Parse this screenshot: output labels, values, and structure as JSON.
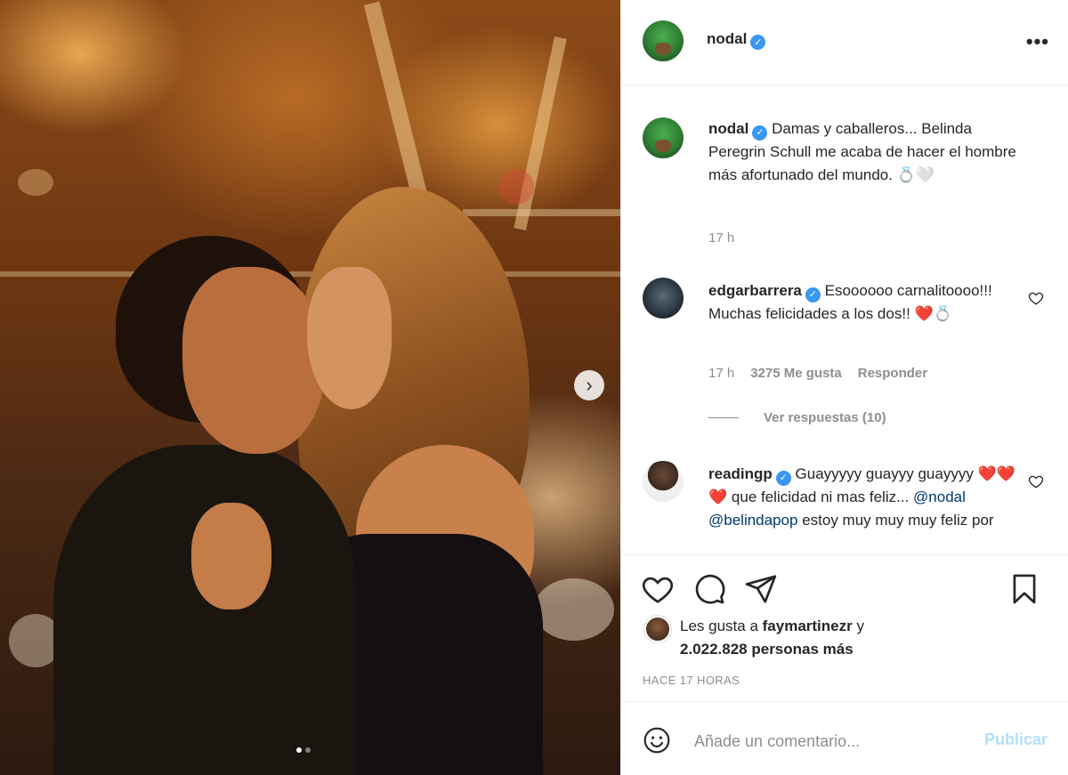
{
  "post": {
    "username": "nodal",
    "more_label": "•••",
    "next_label": "›"
  },
  "caption": {
    "username": "nodal",
    "text": "Damas y caballeros... Belinda Peregrin Schull me acaba de hacer el hombre más afortunado del mundo.",
    "emoji_ring": "💍",
    "emoji_heart": "🤍",
    "time": "17 h"
  },
  "comments": [
    {
      "username": "edgarbarrera",
      "text": "Esoooooo carnalitoooo!!! Muchas felicidades a los dos!!",
      "emoji_heart": "❤️",
      "emoji_ring": "💍",
      "time": "17 h",
      "likes": "3275 Me gusta",
      "reply_label": "Responder",
      "view_replies": "Ver respuestas (10)"
    },
    {
      "username": "readingp",
      "text_start": "Guayyyyy guayyy guayyyy",
      "emoji_hearts": "❤️❤️❤️",
      "text_mid": "que felicidad ni mas feliz...",
      "mention_1": "@nodal",
      "mention_2": "@belindapop",
      "text_end": "estoy muy muy muy feliz por"
    }
  ],
  "likes": {
    "prefix": "Les gusta a",
    "user": "faymartinezr",
    "joiner": "y",
    "count": "2.022.828 personas más"
  },
  "timestamp": "HACE 17 HORAS",
  "add_comment": {
    "placeholder": "Añade un comentario...",
    "publish_label": "Publicar"
  },
  "carousel": {
    "current": 1,
    "total": 2
  }
}
